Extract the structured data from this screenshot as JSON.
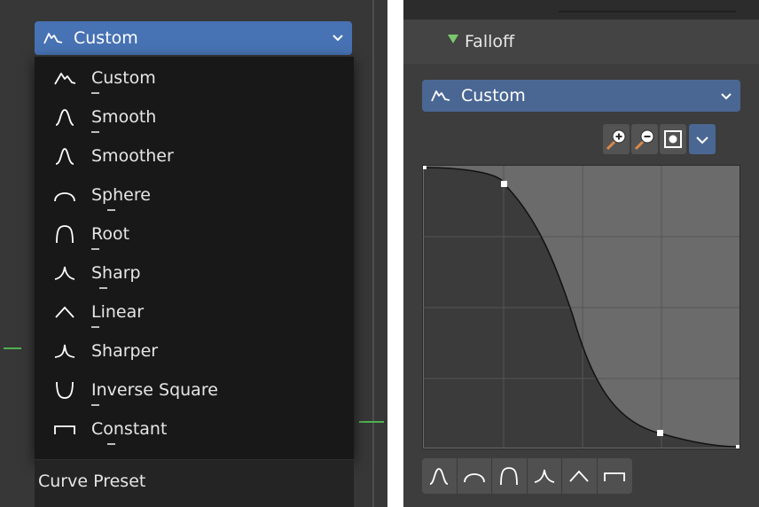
{
  "left": {
    "dropdown": {
      "icon": "custom-curve-icon",
      "label": "Custom"
    },
    "menu_items": [
      {
        "label": "Custom",
        "icon": "custom-curve-icon"
      },
      {
        "label": "Smooth",
        "icon": "smooth-curve-icon"
      },
      {
        "label": "Smoother",
        "icon": "smoother-curve-icon"
      },
      {
        "label": "Sphere",
        "icon": "sphere-curve-icon"
      },
      {
        "label": "Root",
        "icon": "root-curve-icon"
      },
      {
        "label": "Sharp",
        "icon": "sharp-curve-icon"
      },
      {
        "label": "Linear",
        "icon": "linear-curve-icon"
      },
      {
        "label": "Sharper",
        "icon": "sharper-curve-icon"
      },
      {
        "label": "Inverse Square",
        "icon": "inverse-square-curve-icon"
      },
      {
        "label": "Constant",
        "icon": "constant-curve-icon"
      }
    ],
    "footer_label": "Curve Preset"
  },
  "right": {
    "section_label": "Falloff",
    "dropdown": {
      "icon": "custom-curve-icon",
      "label": "Custom"
    },
    "toolbar": [
      "zoom-in-icon",
      "zoom-out-icon",
      "clip-icon",
      "chevron-down-icon"
    ],
    "preset_buttons": [
      "smooth-curve-icon",
      "sphere-curve-icon",
      "root-curve-icon",
      "sharp-curve-icon",
      "linear-curve-icon",
      "constant-curve-icon"
    ]
  },
  "colors": {
    "accent_blue": "#4772b3",
    "panel_bg": "#3d3d3d",
    "menu_bg": "#181818",
    "falloff_triangle": "#7bc86c"
  }
}
